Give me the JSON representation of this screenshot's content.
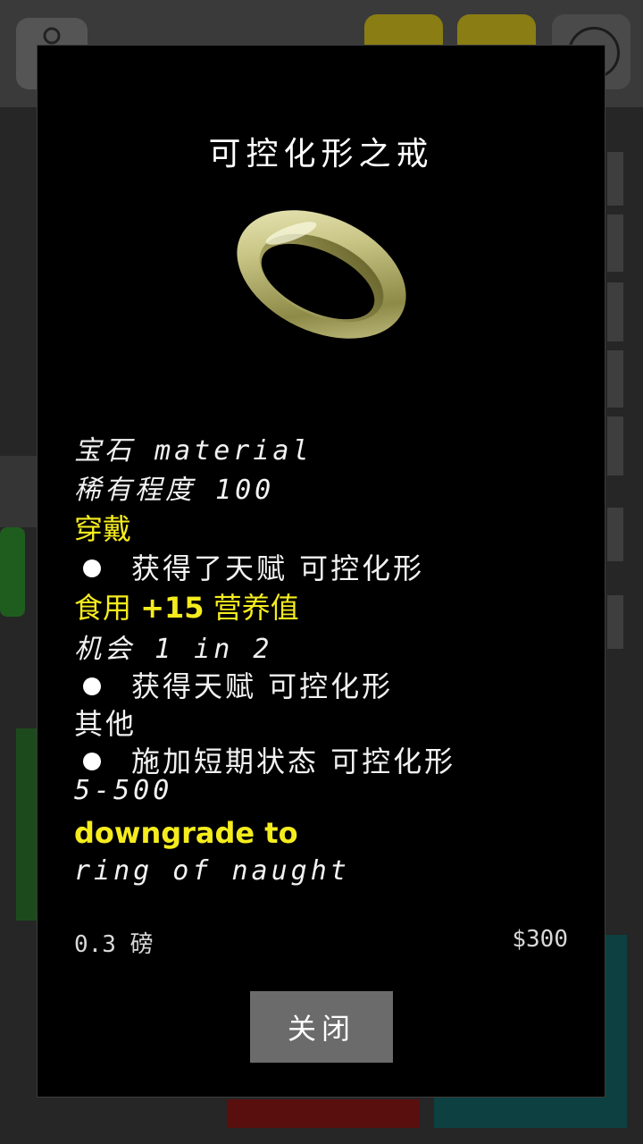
{
  "item": {
    "title": "可控化形之戒",
    "image_icon": "gold-ring-icon"
  },
  "details": {
    "material": "宝石 material",
    "rarity": "稀有程度 100",
    "wear_heading": "穿戴",
    "wear_effect": "获得了天赋 可控化形",
    "eat_heading_prefix": "食用 ",
    "eat_heading_bold": "+15",
    "eat_heading_suffix": " 营养值",
    "chance": "机会 1 in 2",
    "eat_effect": "获得天赋 可控化形",
    "other_heading": "其他",
    "other_effect": "施加短期状态 可控化形",
    "duration": "5-500",
    "downgrade_heading": "downgrade to",
    "downgrade_item": "ring of naught"
  },
  "footer": {
    "weight": "0.3 磅",
    "price": "$300"
  },
  "close_label": "关闭",
  "colors": {
    "heading": "#f5ec1e",
    "text": "#f2f2f2",
    "modal_bg": "#000000",
    "button_bg": "#6b6b6b"
  }
}
